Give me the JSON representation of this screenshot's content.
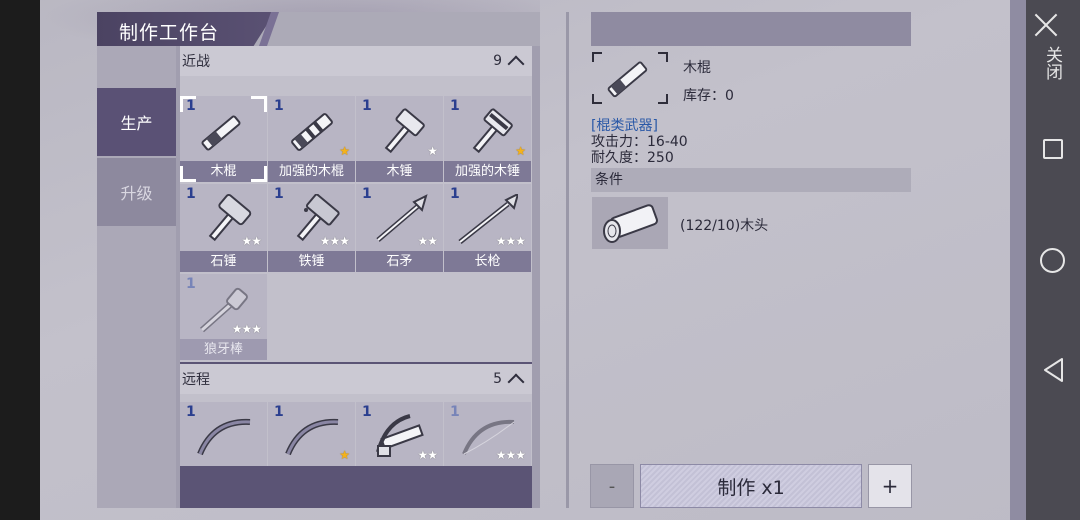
{
  "title": "制作工作台",
  "side_tabs": [
    {
      "label": "生产",
      "active": true
    },
    {
      "label": "升级",
      "active": false
    }
  ],
  "categories": {
    "melee": {
      "label": "近战",
      "count": "9",
      "items": [
        {
          "num": "1",
          "name": "木棍",
          "stars": "",
          "star_color": "",
          "selected": true,
          "dim": false,
          "icon": "wooden-stick-icon"
        },
        {
          "num": "1",
          "name": "加强的木棍",
          "stars": "★",
          "star_color": "gold",
          "dim": false,
          "icon": "reinforced-stick-icon"
        },
        {
          "num": "1",
          "name": "木锤",
          "stars": "★",
          "star_color": "white",
          "dim": false,
          "icon": "wooden-hammer-icon"
        },
        {
          "num": "1",
          "name": "加强的木锤",
          "stars": "★",
          "star_color": "gold",
          "dim": false,
          "icon": "reinforced-hammer-icon"
        },
        {
          "num": "1",
          "name": "石锤",
          "stars": "★★",
          "star_color": "white",
          "dim": false,
          "icon": "stone-hammer-icon"
        },
        {
          "num": "1",
          "name": "铁锤",
          "stars": "★★★",
          "star_color": "white",
          "dim": false,
          "icon": "iron-hammer-icon"
        },
        {
          "num": "1",
          "name": "石矛",
          "stars": "★★",
          "star_color": "white",
          "dim": false,
          "icon": "stone-spear-icon"
        },
        {
          "num": "1",
          "name": "长枪",
          "stars": "★★★",
          "star_color": "white",
          "dim": false,
          "icon": "long-spear-icon"
        },
        {
          "num": "1",
          "name": "狼牙棒",
          "stars": "★★★",
          "star_color": "white",
          "dim": true,
          "icon": "spiked-club-icon"
        }
      ]
    },
    "ranged": {
      "label": "远程",
      "count": "5",
      "items": [
        {
          "num": "1",
          "stars": "",
          "star_color": "",
          "dim": false,
          "icon": "bow-icon"
        },
        {
          "num": "1",
          "stars": "★",
          "star_color": "gold",
          "dim": false,
          "icon": "reinforced-bow-icon"
        },
        {
          "num": "1",
          "stars": "★★",
          "star_color": "white",
          "dim": false,
          "icon": "crossbow-icon"
        },
        {
          "num": "1",
          "stars": "★★★",
          "star_color": "white",
          "dim": true,
          "icon": "longbow-icon"
        }
      ]
    }
  },
  "detail": {
    "name": "木棍",
    "stock": "库存：0",
    "type": "[棍类武器]",
    "attack": "攻击力：16-40",
    "durability": "耐久度：250",
    "conditions_label": "条件",
    "material": "(122/10)木头",
    "material_icon": "wood-log-icon"
  },
  "actions": {
    "minus": "-",
    "make": "制作 x1",
    "plus": "+"
  },
  "system_nav": {
    "close_label": "关闭"
  },
  "colors": {
    "accent": "#5a5175",
    "type_text": "#2b59a7",
    "gold_star": "#f4b21a"
  }
}
